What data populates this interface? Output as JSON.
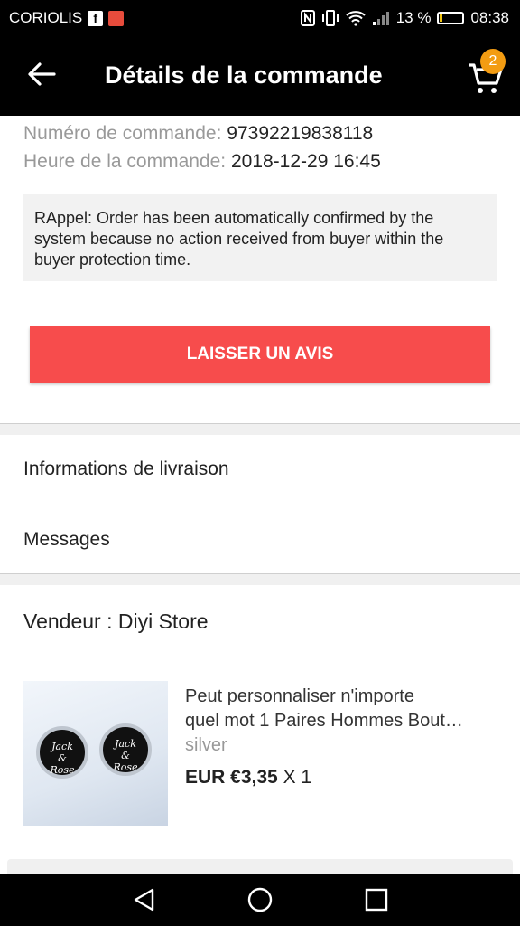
{
  "status_bar": {
    "carrier": "CORIOLIS",
    "battery_percent": "13 %",
    "battery_level": 0.13,
    "time": "08:38",
    "icons": [
      "facebook-icon",
      "mail-icon",
      "nfc-icon",
      "vibrate-icon",
      "wifi-icon",
      "signal-icon",
      "battery-icon"
    ]
  },
  "app_bar": {
    "title": "Détails de la commande",
    "cart_count": "2"
  },
  "order": {
    "number_label": "Numéro de commande:",
    "number_value": "97392219838118",
    "time_label": "Heure de la commande:",
    "time_value": "2018-12-29 16:45"
  },
  "reminder": "RAppel: Order has been automatically confirmed by the system because no action received from buyer within the buyer protection time.",
  "review_button": "LAISSER UN AVIS",
  "links": {
    "shipping": "Informations de livraison",
    "messages": "Messages"
  },
  "seller": "Vendeur : Diyi Store",
  "product": {
    "title_line1": "Peut personnaliser n'importe",
    "title_line2": "quel mot 1 Paires Hommes Bout…",
    "variant": "silver",
    "price": "EUR €3,35",
    "quantity": "X 1",
    "engraving_left": [
      "Jack",
      "&",
      "Rose"
    ],
    "engraving_right": [
      "Jack",
      "&",
      "Rose"
    ]
  },
  "colors": {
    "accent": "#f74c4c",
    "badge": "#f39c12"
  }
}
